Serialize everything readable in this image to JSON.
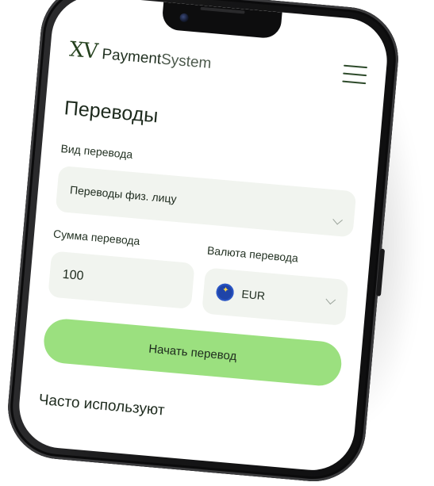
{
  "brand": {
    "mark": "XV",
    "name_bold": "Payment",
    "name_light": "System"
  },
  "page": {
    "title": "Переводы"
  },
  "transfer_type": {
    "label": "Вид перевода",
    "value": "Переводы физ. лицу"
  },
  "amount": {
    "label": "Сумма перевода",
    "value": "100"
  },
  "currency": {
    "label": "Валюта перевода",
    "value": "EUR",
    "flag_icon": "eu-flag-icon"
  },
  "cta": {
    "label": "Начать перевод"
  },
  "frequent": {
    "title": "Часто используют"
  },
  "colors": {
    "accent": "#9be07f",
    "field_bg": "#f1f4ef",
    "brand_text": "#1f3a22"
  }
}
